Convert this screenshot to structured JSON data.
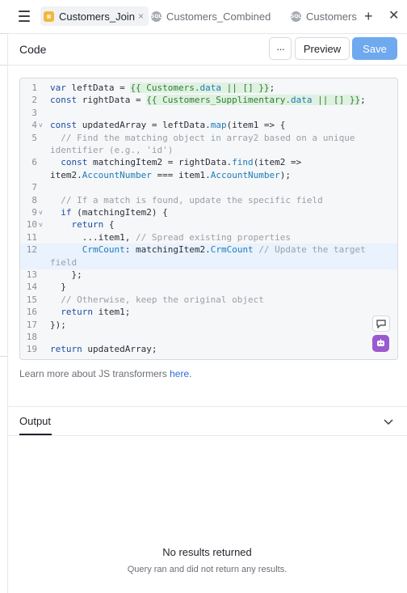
{
  "tabs": [
    {
      "label": "Customers_Join",
      "active": true,
      "close": "×"
    },
    {
      "label": "Customers_Combined",
      "badge": "SQL"
    },
    {
      "label": "Customers",
      "badge": "SQL"
    }
  ],
  "tab_actions": {
    "add": "+",
    "close": "✕"
  },
  "header": {
    "title": "Code",
    "more_label": "···",
    "preview_label": "Preview",
    "save_label": "Save"
  },
  "editor": {
    "lines": [
      {
        "n": "1",
        "fold": "",
        "text": "var leftData = {{ Customers.data || [] }};"
      },
      {
        "n": "2",
        "fold": "",
        "text": "const rightData = {{ Customers_Supplimentary.data || [] }};"
      },
      {
        "n": "3",
        "fold": "",
        "text": ""
      },
      {
        "n": "4",
        "fold": "v",
        "text": "const updatedArray = leftData.map(item1 => {"
      },
      {
        "n": "5",
        "fold": "",
        "text": "  // Find the matching object in array2 based on a unique"
      },
      {
        "n": "",
        "fold": "",
        "text": "identifier (e.g., 'id')"
      },
      {
        "n": "6",
        "fold": "",
        "text": "  const matchingItem2 = rightData.find(item2 =>"
      },
      {
        "n": "",
        "fold": "",
        "text": "item2.AccountNumber === item1.AccountNumber);"
      },
      {
        "n": "7",
        "fold": "",
        "text": ""
      },
      {
        "n": "8",
        "fold": "",
        "text": "  // If a match is found, update the specific field"
      },
      {
        "n": "9",
        "fold": "v",
        "text": "  if (matchingItem2) {"
      },
      {
        "n": "10",
        "fold": "v",
        "text": "    return {"
      },
      {
        "n": "11",
        "fold": "",
        "text": "      ...item1, // Spread existing properties"
      },
      {
        "n": "12",
        "fold": "",
        "text": "      CrmCount: matchingItem2.CrmCount // Update the target"
      },
      {
        "n": "",
        "fold": "",
        "text": "field"
      },
      {
        "n": "13",
        "fold": "",
        "text": "    };"
      },
      {
        "n": "14",
        "fold": "",
        "text": "  }"
      },
      {
        "n": "15",
        "fold": "",
        "text": "  // Otherwise, keep the original object"
      },
      {
        "n": "16",
        "fold": "",
        "text": "  return item1;"
      },
      {
        "n": "17",
        "fold": "",
        "text": "});"
      },
      {
        "n": "18",
        "fold": "",
        "text": ""
      },
      {
        "n": "19",
        "fold": "",
        "text": "return updatedArray;"
      }
    ],
    "highlighted_line": "12"
  },
  "learn_more": {
    "text": "Learn more about JS transformers ",
    "link": "here."
  },
  "output": {
    "title": "Output",
    "empty_title": "No results returned",
    "empty_sub": "Query ran and did not return any results."
  },
  "colors": {
    "save_bg": "#6fa9ef",
    "link": "#2a6fd6",
    "ai_button": "#9b59d0",
    "tab_active_icon": "#f4b63f"
  }
}
